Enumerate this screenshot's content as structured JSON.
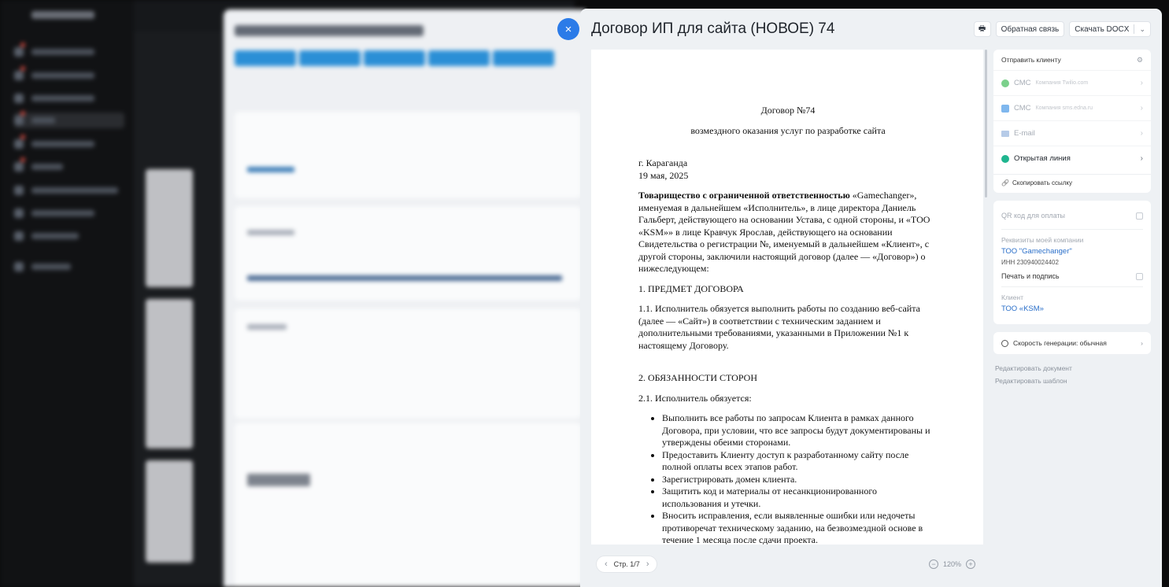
{
  "slider": {
    "title": "Договор ИП для сайта (НОВОЕ) 74",
    "close_icon": "×",
    "print_icon": "🖶",
    "feedback_label": "Обратная связь",
    "download_label": "Скачать DOCX",
    "download_chevron": "⌄"
  },
  "document": {
    "heading": "Договор №74",
    "subheading": "возмездного оказания услуг по разработке сайта",
    "city": "г. Караганда",
    "date": "19 мая, 2025",
    "intro_bold": "Товарищество с ограниченной ответственностью",
    "intro_rest": " «Gamechanger», именуемая в дальнейшем «Исполнитель», в лице директора Даниель Гальберт, действующего на основании Устава, с одной стороны, и  «ТОО «KSM»» в лице Кравчук Ярослав, действующего на основании Свидетельства о регистрации №,  именуемый в дальнейшем «Клиент», с другой стороны, заключили настоящий договор (далее — «Договор») о нижеследующем:",
    "section1_title": "1. ПРЕДМЕТ ДОГОВОРА",
    "section1_p1": "1.1. Исполнитель обязуется выполнить работы по созданию веб-сайта (далее — «Сайт») в соответствии с техническим заданием и дополнительными требованиями, указанными в Приложении №1 к настоящему Договору.",
    "section2_title": "2. ОБЯЗАННОСТИ СТОРОН",
    "section2_p1": "2.1. Исполнитель обязуется:",
    "section2_items": [
      "Выполнить все работы по запросам Клиента в рамках данного Договора, при условии, что все запросы будут документированы и утверждены обеими сторонами.",
      "Предоставить Клиенту доступ к разработанному сайту после полной оплаты всех этапов работ.",
      "Зарегистрировать домен клиента.",
      "Защитить код и материалы от несанкционированного использования и утечки.",
      "Вносить исправления, если выявленные ошибки или недочеты противоречат техническому заданию, на безвозмездной основе в течение 1 месяца после сдачи проекта."
    ]
  },
  "viewer": {
    "page_label": "Стр. 1/7",
    "prev_icon": "‹",
    "next_icon": "›",
    "zoom_level": "120%",
    "zoom_out_icon": "−",
    "zoom_in_icon": "+"
  },
  "send": {
    "title": "Отправить клиенту",
    "gear_icon": "⚙",
    "chevron_icon": "›",
    "rows": [
      {
        "label": "СМС",
        "sub": "Компания Twilio.com",
        "color": "#7bd08b"
      },
      {
        "label": "СМС",
        "sub": "Компания sms.edna.ru",
        "color": "#7fb7ee"
      },
      {
        "label": "E-mail",
        "sub": "",
        "color": "#b6cbe8"
      },
      {
        "label": "Открытая линия",
        "sub": "",
        "color": "#1fb58f"
      }
    ],
    "copy_link_icon": "🔗",
    "copy_link": "Скопировать ссылку"
  },
  "info": {
    "qr_label": "QR код для оплаты",
    "company_label": "Реквизиты моей компании",
    "company_name": "ТОО \"Gamechanger\"",
    "company_inn": "ИНН 230940024402",
    "print_sign_label": "Печать и подпись",
    "client_label": "Клиент",
    "client_name": "ТОО «KSM»"
  },
  "speed": {
    "label": "Скорость генерации: обычная"
  },
  "edit": {
    "edit_document": "Редактировать документ",
    "edit_template": "Редактировать шаблон"
  }
}
